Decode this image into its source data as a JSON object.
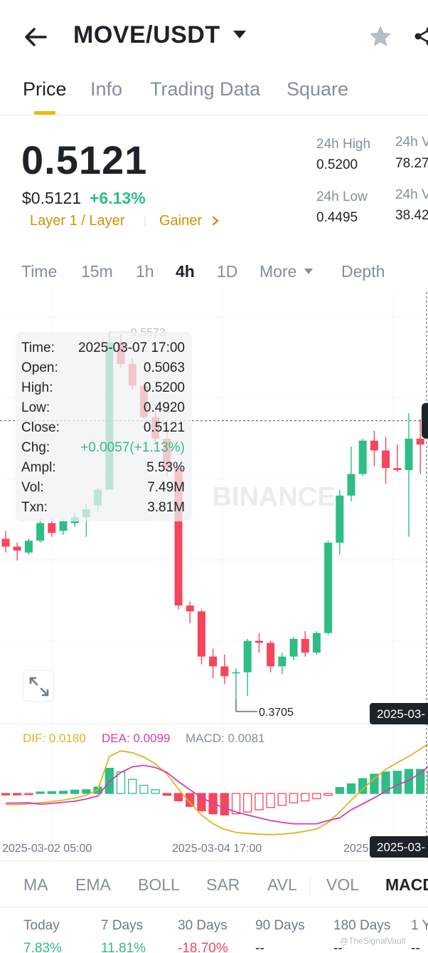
{
  "header": {
    "pair": "MOVE/USDT",
    "icons": [
      "back-arrow-icon",
      "caret-down-icon",
      "star-icon",
      "share-icon"
    ]
  },
  "tabs": [
    {
      "label": "Price",
      "active": true
    },
    {
      "label": "Info",
      "active": false
    },
    {
      "label": "Trading Data",
      "active": false
    },
    {
      "label": "Square",
      "active": false
    }
  ],
  "price": {
    "last": "0.5121",
    "usd": "$0.5121",
    "change_pct": "+6.13%",
    "tags": [
      "Layer 1 / Layer",
      "Gainer"
    ]
  },
  "stats": {
    "high_label": "24h High",
    "high_value": "0.5200",
    "low_label": "24h Low",
    "low_value": "0.4495",
    "vol1_label": "24h V",
    "vol1_value": "78.27",
    "vol2_label": "24h V",
    "vol2_value": "38.42"
  },
  "intervals": [
    {
      "label": "Time",
      "active": false
    },
    {
      "label": "15m",
      "active": false
    },
    {
      "label": "1h",
      "active": false
    },
    {
      "label": "4h",
      "active": true
    },
    {
      "label": "1D",
      "active": false
    },
    {
      "label": "More",
      "active": false
    },
    {
      "label": "Depth",
      "active": false
    }
  ],
  "tooltip": {
    "time_k": "Time:",
    "time_v": "2025-03-07 17:00",
    "open_k": "Open:",
    "open_v": "0.5063",
    "high_k": "High:",
    "high_v": "0.5200",
    "low_k": "Low:",
    "low_v": "0.4920",
    "close_k": "Close:",
    "close_v": "0.5121",
    "chg_k": "Chg:",
    "chg_v": "+0.0057(+1.13%)",
    "ampl_k": "Ampl:",
    "ampl_v": "5.53%",
    "vol_k": "Vol:",
    "vol_v": "7.49M",
    "txn_k": "Txn:",
    "txn_v": "3.81M"
  },
  "chart_data": {
    "type": "candlestick",
    "watermark": "BINANCE",
    "high_marker": "0.5573",
    "low_marker": "0.3705",
    "colors": {
      "up": "#2ebd85",
      "down": "#f6465d"
    },
    "candles": [
      {
        "o": 0.452,
        "h": 0.456,
        "l": 0.445,
        "c": 0.448
      },
      {
        "o": 0.448,
        "h": 0.45,
        "l": 0.441,
        "c": 0.446
      },
      {
        "o": 0.445,
        "h": 0.452,
        "l": 0.444,
        "c": 0.451
      },
      {
        "o": 0.451,
        "h": 0.462,
        "l": 0.45,
        "c": 0.46
      },
      {
        "o": 0.46,
        "h": 0.462,
        "l": 0.453,
        "c": 0.455
      },
      {
        "o": 0.456,
        "h": 0.462,
        "l": 0.454,
        "c": 0.461
      },
      {
        "o": 0.46,
        "h": 0.465,
        "l": 0.458,
        "c": 0.463
      },
      {
        "o": 0.463,
        "h": 0.47,
        "l": 0.453,
        "c": 0.467
      },
      {
        "o": 0.469,
        "h": 0.478,
        "l": 0.466,
        "c": 0.477
      },
      {
        "o": 0.477,
        "h": 0.5573,
        "l": 0.477,
        "c": 0.552
      },
      {
        "o": 0.552,
        "h": 0.556,
        "l": 0.539,
        "c": 0.541
      },
      {
        "o": 0.541,
        "h": 0.544,
        "l": 0.528,
        "c": 0.53
      },
      {
        "o": 0.53,
        "h": 0.531,
        "l": 0.513,
        "c": 0.514
      },
      {
        "o": 0.514,
        "h": 0.52,
        "l": 0.501,
        "c": 0.503
      },
      {
        "o": 0.503,
        "h": 0.509,
        "l": 0.484,
        "c": 0.488
      },
      {
        "o": 0.488,
        "h": 0.489,
        "l": 0.416,
        "c": 0.418
      },
      {
        "o": 0.418,
        "h": 0.42,
        "l": 0.409,
        "c": 0.415
      },
      {
        "o": 0.415,
        "h": 0.416,
        "l": 0.388,
        "c": 0.392
      },
      {
        "o": 0.392,
        "h": 0.396,
        "l": 0.381,
        "c": 0.387
      },
      {
        "o": 0.387,
        "h": 0.393,
        "l": 0.378,
        "c": 0.382
      },
      {
        "o": 0.384,
        "h": 0.386,
        "l": 0.3705,
        "c": 0.384
      },
      {
        "o": 0.384,
        "h": 0.401,
        "l": 0.372,
        "c": 0.4
      },
      {
        "o": 0.4,
        "h": 0.404,
        "l": 0.394,
        "c": 0.399
      },
      {
        "o": 0.399,
        "h": 0.4,
        "l": 0.384,
        "c": 0.387
      },
      {
        "o": 0.387,
        "h": 0.394,
        "l": 0.383,
        "c": 0.392
      },
      {
        "o": 0.392,
        "h": 0.402,
        "l": 0.39,
        "c": 0.401
      },
      {
        "o": 0.401,
        "h": 0.405,
        "l": 0.392,
        "c": 0.394
      },
      {
        "o": 0.394,
        "h": 0.405,
        "l": 0.393,
        "c": 0.404
      },
      {
        "o": 0.404,
        "h": 0.451,
        "l": 0.403,
        "c": 0.45
      },
      {
        "o": 0.45,
        "h": 0.477,
        "l": 0.444,
        "c": 0.474
      },
      {
        "o": 0.474,
        "h": 0.499,
        "l": 0.471,
        "c": 0.485
      },
      {
        "o": 0.485,
        "h": 0.503,
        "l": 0.484,
        "c": 0.502
      },
      {
        "o": 0.502,
        "h": 0.507,
        "l": 0.489,
        "c": 0.497
      },
      {
        "o": 0.497,
        "h": 0.504,
        "l": 0.48,
        "c": 0.488
      },
      {
        "o": 0.488,
        "h": 0.5,
        "l": 0.486,
        "c": 0.487
      },
      {
        "o": 0.487,
        "h": 0.516,
        "l": 0.453,
        "c": 0.503
      },
      {
        "o": 0.503,
        "h": 0.513,
        "l": 0.485,
        "c": 0.5
      },
      {
        "o": 0.5,
        "h": 0.512,
        "l": 0.496,
        "c": 0.499
      },
      {
        "o": 0.5,
        "h": 0.517,
        "l": 0.499,
        "c": 0.509
      },
      {
        "o": 0.5063,
        "h": 0.52,
        "l": 0.492,
        "c": 0.5121
      }
    ],
    "macd": {
      "dif_label": "DIF: 0.0180",
      "dea_label": "DEA: 0.0099",
      "macd_label": "MACD: 0.0081",
      "colors": {
        "dif": "#e0b31e",
        "dea": "#d63caf",
        "up": "#2ebd85",
        "down": "#f6465d"
      },
      "hist": [
        -0.0004,
        -0.0004,
        -0.0003,
        0.0004,
        0.0005,
        0.0006,
        0.0009,
        0.001,
        0.0017,
        0.0068,
        0.0058,
        0.0038,
        0.0022,
        0.001,
        -0.0005,
        -0.002,
        -0.0035,
        -0.0047,
        -0.0055,
        -0.0058,
        -0.0055,
        -0.005,
        -0.0044,
        -0.0038,
        -0.0032,
        -0.0025,
        -0.002,
        -0.0014,
        -0.0005,
        0.0016,
        0.0026,
        0.004,
        0.0052,
        0.0058,
        0.006,
        0.0065,
        0.0065,
        0.006,
        0.007,
        0.0081
      ],
      "dif": [
        -0.003,
        -0.003,
        -0.0028,
        -0.0025,
        -0.0022,
        -0.0018,
        -0.0012,
        -0.0005,
        0.001,
        0.01,
        0.0115,
        0.011,
        0.0098,
        0.008,
        0.0052,
        0.0012,
        -0.0025,
        -0.0058,
        -0.0082,
        -0.0097,
        -0.0105,
        -0.0108,
        -0.011,
        -0.0111,
        -0.011,
        -0.0107,
        -0.0102,
        -0.0096,
        -0.0078,
        -0.005,
        -0.0018,
        0.0012,
        0.004,
        0.0065,
        0.0083,
        0.01,
        0.012,
        0.014,
        0.016,
        0.018
      ],
      "dea": [
        -0.0026,
        -0.0026,
        -0.0025,
        -0.0029,
        -0.0027,
        -0.0024,
        -0.0021,
        -0.0015,
        -0.0007,
        0.0032,
        0.0057,
        0.0072,
        0.0076,
        0.007,
        0.0057,
        0.0032,
        0.001,
        -0.0011,
        -0.0027,
        -0.0039,
        -0.005,
        -0.0058,
        -0.0066,
        -0.0073,
        -0.0078,
        -0.0082,
        -0.0082,
        -0.0082,
        -0.0073,
        -0.0066,
        -0.0044,
        -0.0028,
        -0.0012,
        0.0007,
        0.0023,
        0.0035,
        0.0055,
        0.008,
        0.009,
        0.0099
      ]
    },
    "x_dates": [
      "2025-03-02 05:00",
      "2025-03-04 17:00",
      "2025"
    ],
    "badge_date_1": "2025-03-",
    "badge_date_2": "2025-03-"
  },
  "indicators": [
    {
      "label": "MA",
      "active": false
    },
    {
      "label": "EMA",
      "active": false
    },
    {
      "label": "BOLL",
      "active": false
    },
    {
      "label": "SAR",
      "active": false
    },
    {
      "label": "AVL",
      "active": false
    },
    {
      "label": "VOL",
      "active": false
    },
    {
      "label": "MACD",
      "active": true
    }
  ],
  "performance": [
    {
      "label": "Today",
      "value": "7.83%",
      "color": "#2ebd85"
    },
    {
      "label": "7 Days",
      "value": "11.81%",
      "color": "#2ebd85"
    },
    {
      "label": "30 Days",
      "value": "-18.70%",
      "color": "#f6465d"
    },
    {
      "label": "90 Days",
      "value": "--",
      "color": "#1e2329"
    },
    {
      "label": "180 Days",
      "value": "--",
      "color": "#1e2329"
    },
    {
      "label": "1 Y",
      "value": "--",
      "color": "#1e2329"
    }
  ],
  "watermark_credit": "@TheSignalVault"
}
